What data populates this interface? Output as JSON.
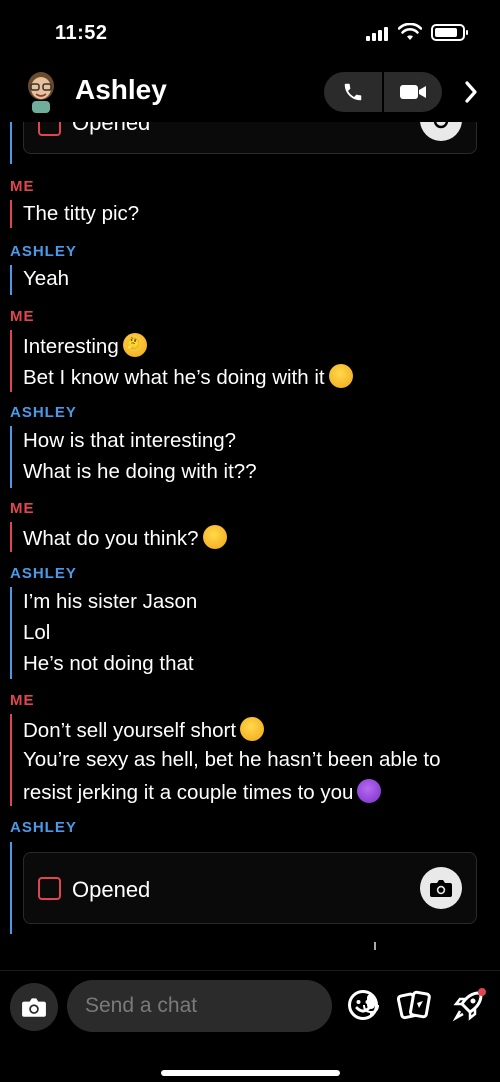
{
  "status_bar": {
    "time": "11:52",
    "battery_level": 0.85
  },
  "header": {
    "contact_name": "Ashley"
  },
  "colors": {
    "me": "#e0464f",
    "friend": "#4a9ae9",
    "background": "#000000",
    "pill": "#2b2b2b"
  },
  "top_snap": {
    "label": "Opened"
  },
  "messages": [
    {
      "sender": "ME",
      "lines": [
        {
          "text": "The titty pic?"
        }
      ]
    },
    {
      "sender": "ASHLEY",
      "lines": [
        {
          "text": "Yeah"
        }
      ]
    },
    {
      "sender": "ME",
      "lines": [
        {
          "text": "Interesting",
          "emoji": "thinking-face"
        },
        {
          "text": "Bet I know what he’s doing with it",
          "emoji": "laughing-face"
        }
      ]
    },
    {
      "sender": "ASHLEY",
      "lines": [
        {
          "text": "How is that interesting?"
        },
        {
          "text": "What is he doing with it??"
        }
      ]
    },
    {
      "sender": "ME",
      "lines": [
        {
          "text": "What do you think?",
          "emoji": "smirking-face"
        }
      ]
    },
    {
      "sender": "ASHLEY",
      "lines": [
        {
          "text": "I’m his sister Jason"
        },
        {
          "text": "Lol"
        },
        {
          "text": "He’s not doing that"
        }
      ]
    },
    {
      "sender": "ME",
      "lines": [
        {
          "text": "Don’t sell yourself short",
          "emoji": "smirking-face"
        },
        {
          "text": "You’re sexy as hell, bet he hasn’t been able to"
        },
        {
          "text": "resist jerking it a couple times to you",
          "emoji": "smiling-devil"
        }
      ]
    },
    {
      "sender": "ASHLEY",
      "lines": []
    }
  ],
  "bottom_snap": {
    "label": "Opened"
  },
  "input": {
    "placeholder": "Send a chat",
    "value": ""
  },
  "icons": {
    "call": "phone-icon",
    "video": "video-camera-icon",
    "more": "chevron-right-icon",
    "camera": "camera-icon",
    "mic": "microphone-icon",
    "stickers": "smiley-icon",
    "cards": "cards-icon",
    "games": "rocket-icon"
  }
}
